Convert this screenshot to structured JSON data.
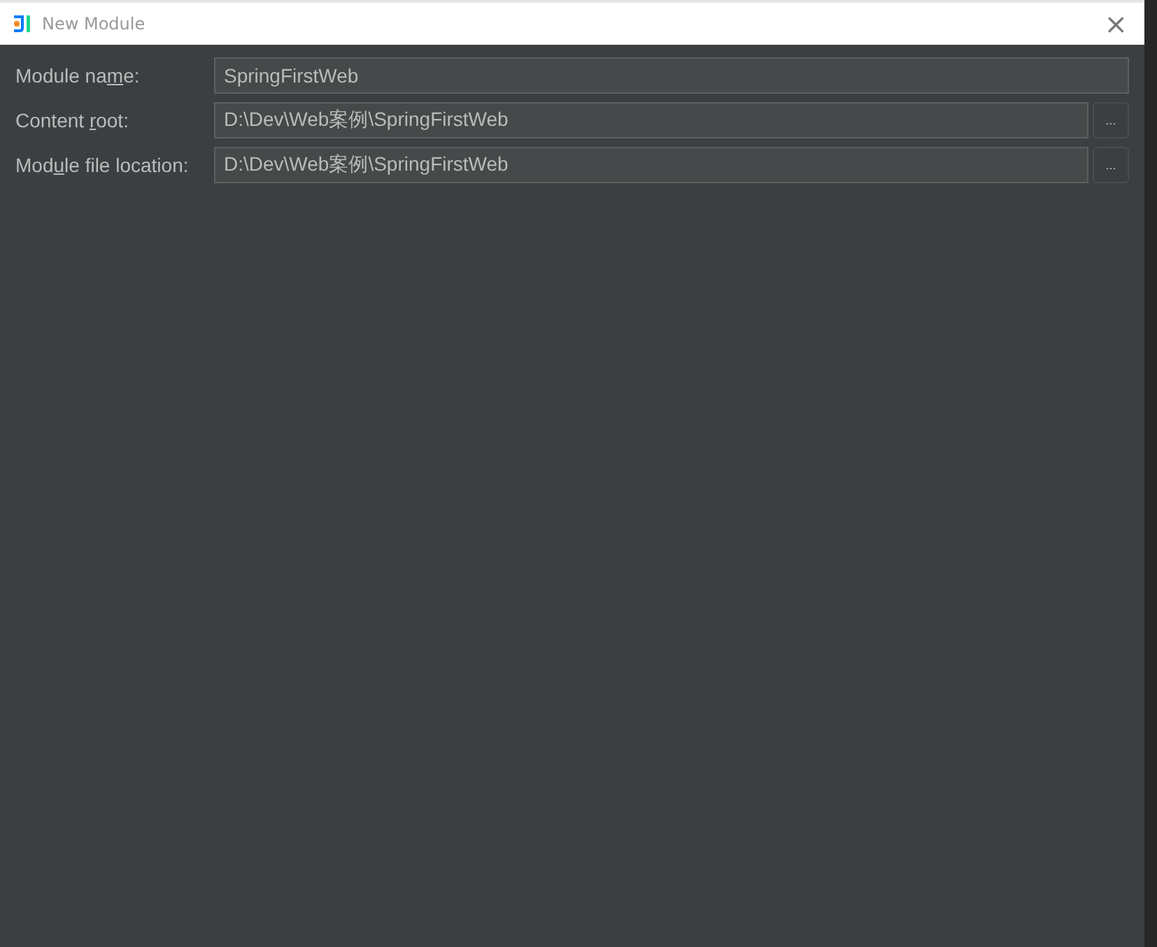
{
  "window": {
    "title": "New Module",
    "close": "×"
  },
  "fields": [
    {
      "label_start": "Module na",
      "mnemonic": "m",
      "label_end": "e:",
      "value": "SpringFirstWeb"
    },
    {
      "label_start": "Content ",
      "mnemonic": "r",
      "label_end": "oot:",
      "value": "D:\\Dev\\Web案例\\SpringFirstWeb",
      "browse": "..."
    },
    {
      "label_start": "Mod",
      "mnemonic": "u",
      "label_end": "le file location:",
      "value": "D:\\Dev\\Web案例\\SpringFirstWeb",
      "browse": "..."
    }
  ]
}
